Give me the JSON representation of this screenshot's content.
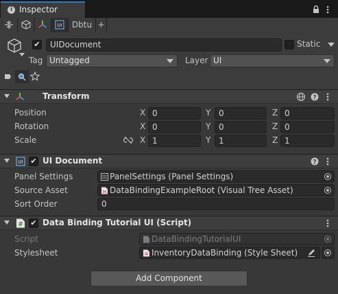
{
  "tabbar": {
    "inspector_label": "Inspector"
  },
  "toolbar": {
    "dbtu_label": "Dbtu",
    "add_label": "+"
  },
  "gameobject": {
    "name": "UIDocument",
    "static_label": "Static",
    "tag_label": "Tag",
    "tag_value": "Untagged",
    "layer_label": "Layer",
    "layer_value": "UI"
  },
  "transform": {
    "title": "Transform",
    "rows": [
      {
        "label": "Position",
        "x": "0",
        "y": "0",
        "z": "0"
      },
      {
        "label": "Rotation",
        "x": "0",
        "y": "0",
        "z": "0"
      },
      {
        "label": "Scale",
        "x": "1",
        "y": "1",
        "z": "1"
      }
    ],
    "axis": {
      "x": "X",
      "y": "Y",
      "z": "Z"
    }
  },
  "ui_document": {
    "title": "UI Document",
    "panel_settings_label": "Panel Settings",
    "panel_settings_value": "PanelSettings (Panel Settings)",
    "source_asset_label": "Source Asset",
    "source_asset_value": "DataBindingExampleRoot (Visual Tree Asset)",
    "sort_order_label": "Sort Order",
    "sort_order_value": "0"
  },
  "script_component": {
    "title": "Data Binding Tutorial UI (Script)",
    "script_label": "Script",
    "script_value": "DataBindingTutorialUI",
    "stylesheet_label": "Stylesheet",
    "stylesheet_value": "InventoryDataBinding (Style Sheet)"
  },
  "add_component_label": "Add Component"
}
